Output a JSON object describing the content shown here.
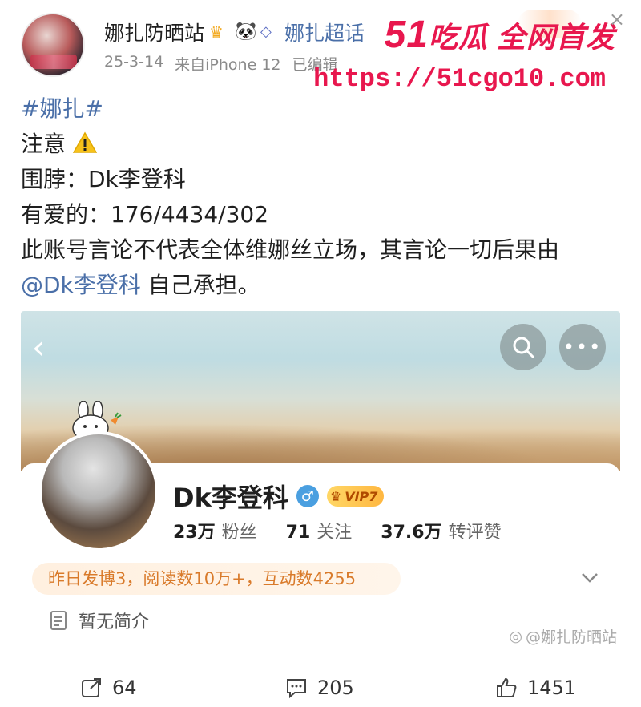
{
  "header": {
    "author_name": "娜扎防晒站",
    "supertopic": "娜扎超话",
    "date": "25-3-14",
    "source": "来自iPhone 12",
    "edited": "已编辑"
  },
  "ad_watermark": {
    "brand_num": "51",
    "brand_text": "吃瓜 全网首发",
    "url": "https://51cgo10.com",
    "glow_text": "超话",
    "close": "×"
  },
  "post": {
    "hashtag": "#娜扎#",
    "line_notice": "注意",
    "line_target": "围脖：Dk李登科",
    "line_stats": "有爱的：176/4434/302",
    "line_disclaimer": "此账号言论不代表全体维娜丝立场，其言论一切后果由",
    "mention": "@Dk李登科",
    "line_end": " 自己承担。"
  },
  "profile_card": {
    "nickname": "Dk李登科",
    "vip_label": "VIP7",
    "stats": [
      {
        "num": "23万",
        "label": "粉丝"
      },
      {
        "num": "71",
        "label": "关注"
      },
      {
        "num": "37.6万",
        "label": "转评赞"
      }
    ],
    "activity": "昨日发博3，阅读数10万+，互动数4255",
    "bio": "暂无简介",
    "watermark": "@娜扎防晒站"
  },
  "actions": {
    "repost_count": "64",
    "comment_count": "205",
    "like_count": "1451"
  },
  "colors": {
    "link": "#4a6fa8",
    "ad_red": "#e8174e",
    "activity_orange": "#d97a2a"
  }
}
